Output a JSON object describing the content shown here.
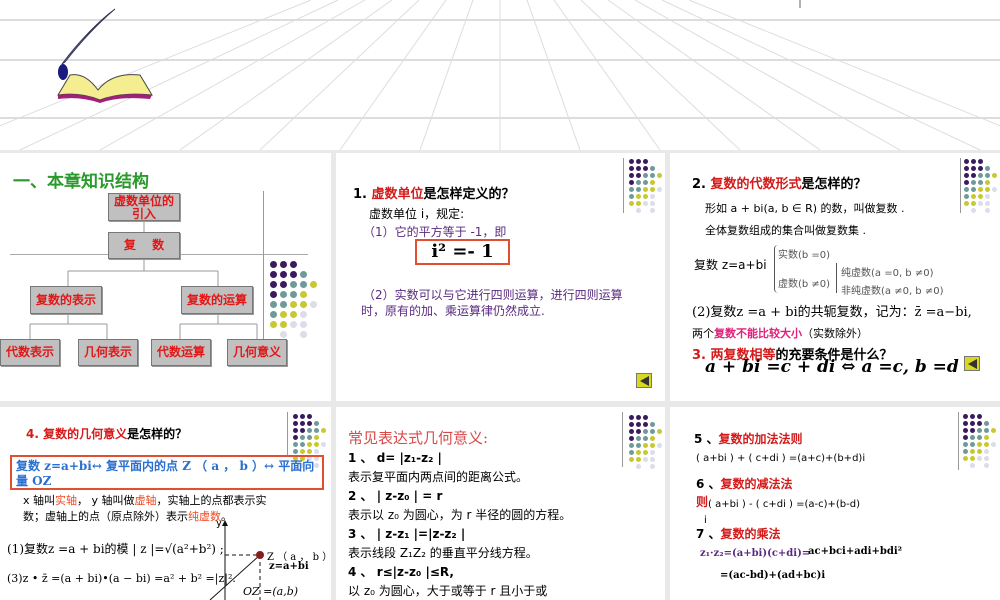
{
  "header_image": "quill-and-book-clipart",
  "panel1": {
    "title": "一、本章知识结构",
    "root": "虚数单位的引入",
    "complex": "复　 数",
    "repr": "复数的表示",
    "ops": "复数的运算",
    "leaves": [
      "代数表示",
      "几何表示",
      "代数运算",
      "几何意义"
    ]
  },
  "panel2": {
    "q_num": "1. ",
    "q_red": "虚数单位",
    "q_rest": "是怎样定义的？",
    "l1": "虚数单位 i，规定:",
    "l2": "（1）它的平方等于 -1，即",
    "formula": "i² =- 1",
    "l3": "（2）实数可以与它进行四则运算，进行四则运算",
    "l4": "时，原有的加、乘运算律仍然成立."
  },
  "panel3": {
    "q_num": "2. ",
    "q_red": "复数的代数形式",
    "q_rest": "是怎样的？",
    "l1": "形如 a + bi(a, b ∈ R) 的数，叫做复数 .",
    "l2": "全体复数组成的集合叫做复数集 .",
    "z": "复数 z=a+bi",
    "real": "实数(b =0)",
    "imag": "虚数(b ≠0)",
    "pure": "纯虚数(a =0, b ≠0)",
    "nonpure": "非纯虚数(a ≠0, b ≠0)",
    "conj": "(2)复数z =a + bi的共轭复数，记为：z̄ =a−bi,",
    "cmp_a": "两个",
    "cmp_red": "复数不能比较大小",
    "cmp_b": "（实数除外）",
    "q3_red": "3. 两复数相等",
    "q3_rest": "的充要条件是什么？",
    "eq": "a + bi =c + di ⇔ a =c, b =d"
  },
  "panel4": {
    "q_red": "4. 复数的几何意义",
    "q_rest": "是怎样的？",
    "box": "复数 z=a+bi↔ 复平面内的点 Z （ a ， b ）↔ 平面向量 OZ",
    "l1a": "x 轴叫",
    "l1r": "实轴",
    "l1b": "， y 轴叫做",
    "l1r2": "虚轴",
    "l1c": "，实轴上的点都表示实",
    "l2a": "数；虚轴上的点（原点除外）表示",
    "l2r": "纯虚数",
    "l2b": "。",
    "f1": "(1)复数z =a + bi的模 | z |=√(a²+b²) ;",
    "f3": "(3)z • z̄ =(a + bi)•(a − bi) =a² + b² =|z|².",
    "y": "y",
    "pt": "Z （ a ， b ）",
    "zlab": "z=a+bi",
    "oz": "OZ =(a,b)"
  },
  "panel5": {
    "title": "常见表达式几何意义:",
    "items": [
      "1 、  d= |z₁-z₂ |",
      "表示复平面内两点间的距离公式。",
      "2 、 |  z-z₀ | = r",
      "表示以 z₀ 为圆心，为 r 半径的圆的方程。",
      "3 、 |  z-z₁ |=|z-z₂ |",
      "表示线段 Z₁Z₂ 的垂直平分线方程。",
      "4 、 r≤|z-z₀ |≤R,",
      "以 z₀ 为圆心，大于或等于 r 且小于或"
    ]
  },
  "panel6": {
    "h5n": "5 、",
    "h5": "复数的加法法则",
    "f5": "( a+bi ) + ( c+di ) =(a+c)+(b+d)i",
    "h6n": "6 、",
    "h6": "复数的减法法",
    "h6b": "则",
    "f6": "( a+bi ) - ( c+di ) =(a-c)+(b-d)",
    "f6b": "i",
    "h7n": "7 、",
    "h7": "复数的乘法",
    "f7a": "z₁·z₂=(a+bi)(c+di)=",
    "f7b": "ac+bci+adi+bdi²",
    "f7c": "=(ac-bd)+(ad+bc)i"
  },
  "colors": {
    "red": "#d41a1a",
    "purple": "#5a2a80",
    "green": "#2a9a2a",
    "dots": [
      "#3b1a5e",
      "#6f9a9a",
      "#c8c830",
      "#dcdcea"
    ]
  }
}
